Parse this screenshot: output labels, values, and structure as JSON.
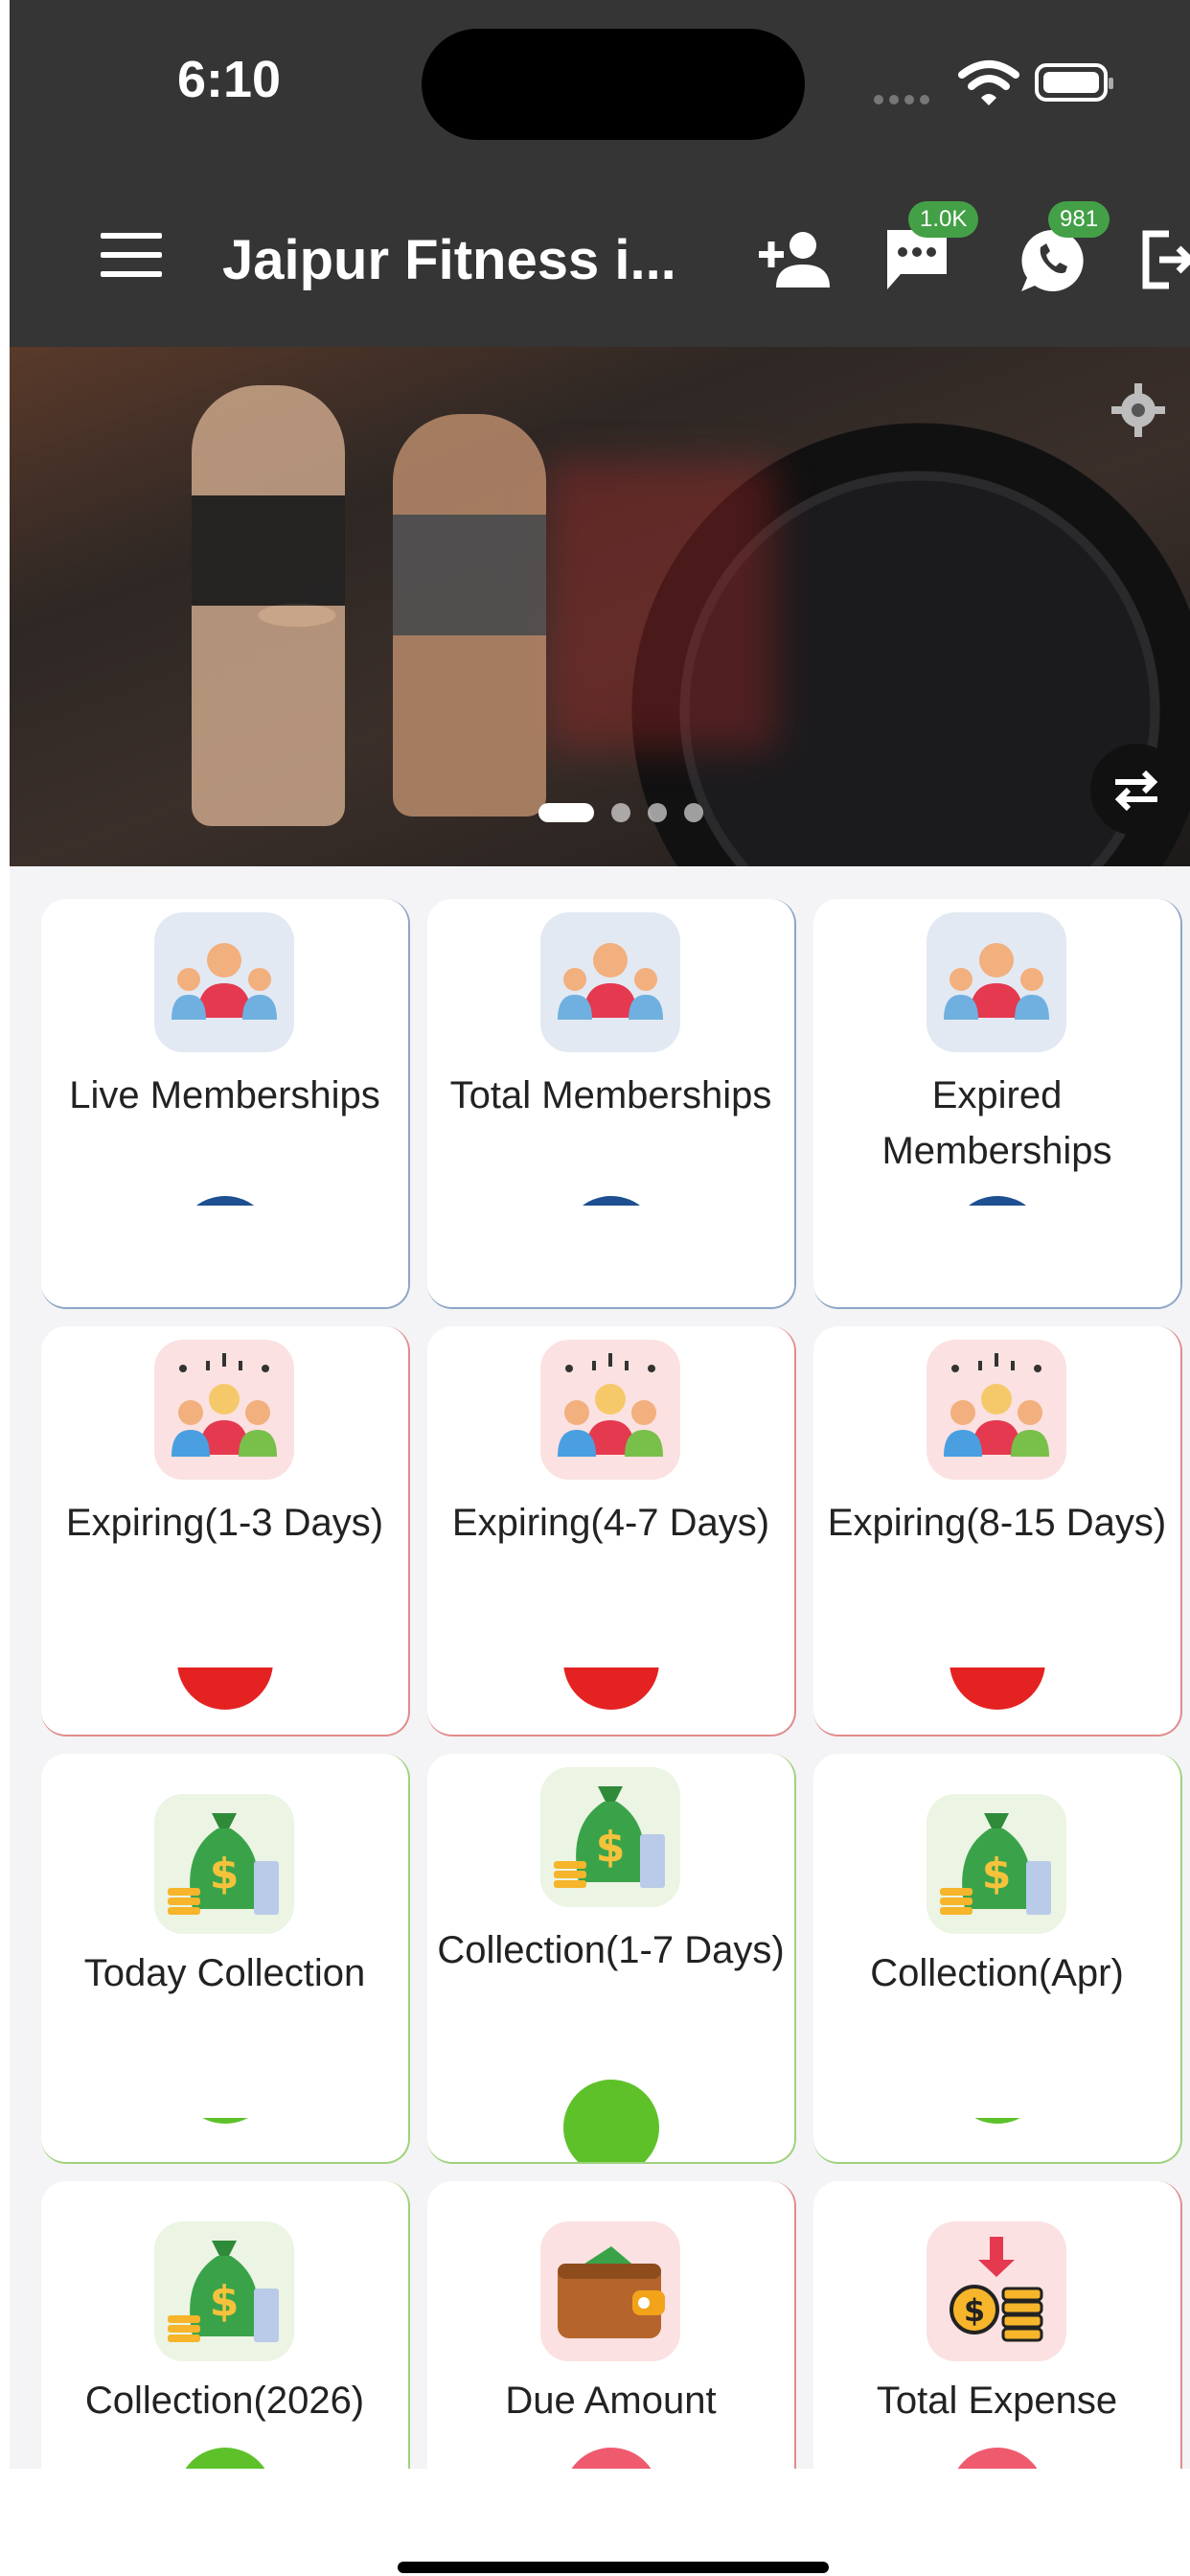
{
  "status_bar": {
    "time": "6:10"
  },
  "app_bar": {
    "title": "Jaipur Fitness i...",
    "sms_badge": "1.0K",
    "whatsapp_badge": "981"
  },
  "banner": {
    "slides": 4,
    "active_slide": 1
  },
  "cards": [
    {
      "label": "Live Memberships",
      "icon": "members-group-icon",
      "theme": "blue"
    },
    {
      "label": "Total Memberships",
      "icon": "members-group-icon",
      "theme": "blue"
    },
    {
      "label": "Expired Memberships",
      "icon": "members-group-icon",
      "theme": "blue"
    },
    {
      "label": "Expiring(1-3 Days)",
      "icon": "celebrating-group-icon",
      "theme": "red"
    },
    {
      "label": "Expiring(4-7 Days)",
      "icon": "celebrating-group-icon",
      "theme": "red"
    },
    {
      "label": "Expiring(8-15 Days)",
      "icon": "celebrating-group-icon",
      "theme": "red"
    },
    {
      "label": "Today Collection",
      "icon": "money-bag-icon",
      "theme": "green"
    },
    {
      "label": "Collection(1-7 Days)",
      "icon": "money-bag-icon",
      "theme": "green"
    },
    {
      "label": "Collection(Apr)",
      "icon": "money-bag-icon",
      "theme": "green"
    },
    {
      "label": "Collection(2026)",
      "icon": "money-bag-icon",
      "theme": "green"
    },
    {
      "label": "Due Amount",
      "icon": "wallet-icon",
      "theme": "red"
    },
    {
      "label": "Total Expense",
      "icon": "expense-coins-icon",
      "theme": "red"
    }
  ],
  "colors": {
    "app_bar": "#353535",
    "blue_theme": "#1d4f91",
    "red_theme": "#e52222",
    "green_theme": "#5ec12a",
    "badge": "#43a047"
  }
}
